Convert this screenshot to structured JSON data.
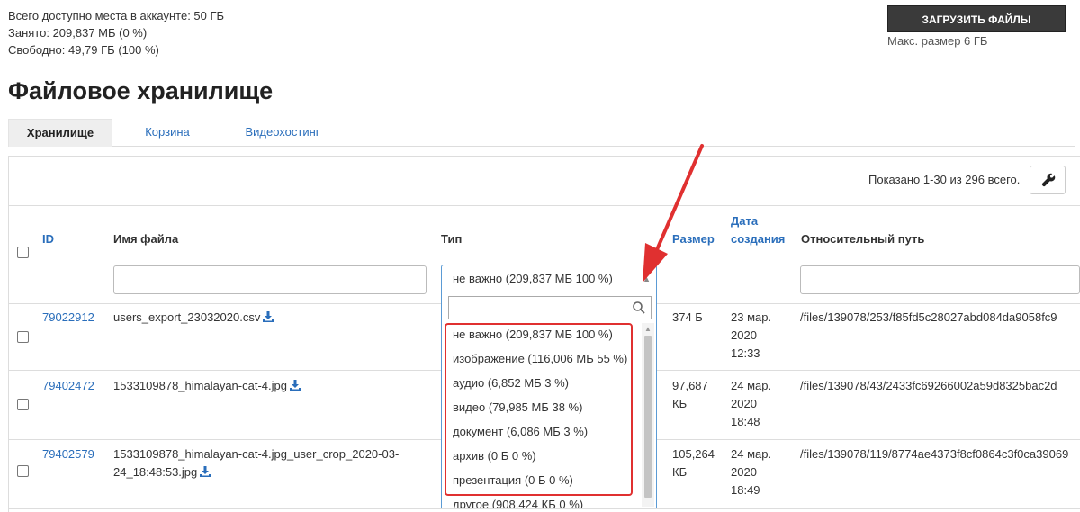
{
  "quota": {
    "total": "Всего доступно места в аккаунте: 50 ГБ",
    "used": "Занято: 209,837 МБ (0 %)",
    "free": "Свободно: 49,79 ГБ (100 %)"
  },
  "upload": {
    "label": "ЗАГРУЗИТЬ ФАЙЛЫ",
    "max_size": "Макс. размер 6 ГБ"
  },
  "title": "Файловое хранилище",
  "tabs": [
    {
      "label": "Хранилище",
      "active": true
    },
    {
      "label": "Корзина",
      "active": false
    },
    {
      "label": "Видеохостинг",
      "active": false
    }
  ],
  "summary": "Показано 1-30 из 296 всего.",
  "columns": {
    "id": "ID",
    "name": "Имя файла",
    "type": "Тип",
    "size": "Размер",
    "date_line1": "Дата",
    "date_line2": "создания",
    "path": "Относительный путь"
  },
  "type_filter": {
    "selected": "не важно (209,837 МБ 100 %)",
    "options": [
      "не важно (209,837 МБ 100 %)",
      "изображение (116,006 МБ 55 %)",
      "аудио (6,852 МБ 3 %)",
      "видео (79,985 МБ 38 %)",
      "документ (6,086 МБ 3 %)",
      "архив (0 Б 0 %)",
      "презентация (0 Б 0 %)",
      "другое (908,424 КБ 0 %)"
    ]
  },
  "rows": [
    {
      "id": "79022912",
      "name_line1": "users_export_23032020.csv",
      "name_line2": "",
      "size_line1": "374 Б",
      "size_line2": "",
      "date_line1": "23 мар.",
      "date_line2": "2020",
      "date_line3": "12:33",
      "path": "/files/139078/253/f85fd5c28027abd084da9058fc9"
    },
    {
      "id": "79402472",
      "name_line1": "1533109878_himalayan-cat-4.jpg",
      "name_line2": "",
      "size_line1": "97,687",
      "size_line2": "КБ",
      "date_line1": "24 мар.",
      "date_line2": "2020",
      "date_line3": "18:48",
      "path": "/files/139078/43/2433fc69266002a59d8325bac2d"
    },
    {
      "id": "79402579",
      "name_line1": "1533109878_himalayan-cat-4.jpg_user_crop_2020-03-",
      "name_line2": "24_18:48:53.jpg",
      "size_line1": "105,264",
      "size_line2": "КБ",
      "date_line1": "24 мар.",
      "date_line2": "2020",
      "date_line3": "18:49",
      "path": "/files/139078/119/8774ae4373f8cf0864c3f0ca39069"
    }
  ],
  "colors": {
    "link": "#2a6ebb",
    "annotation": "#e03030",
    "button": "#3a3a3a"
  }
}
